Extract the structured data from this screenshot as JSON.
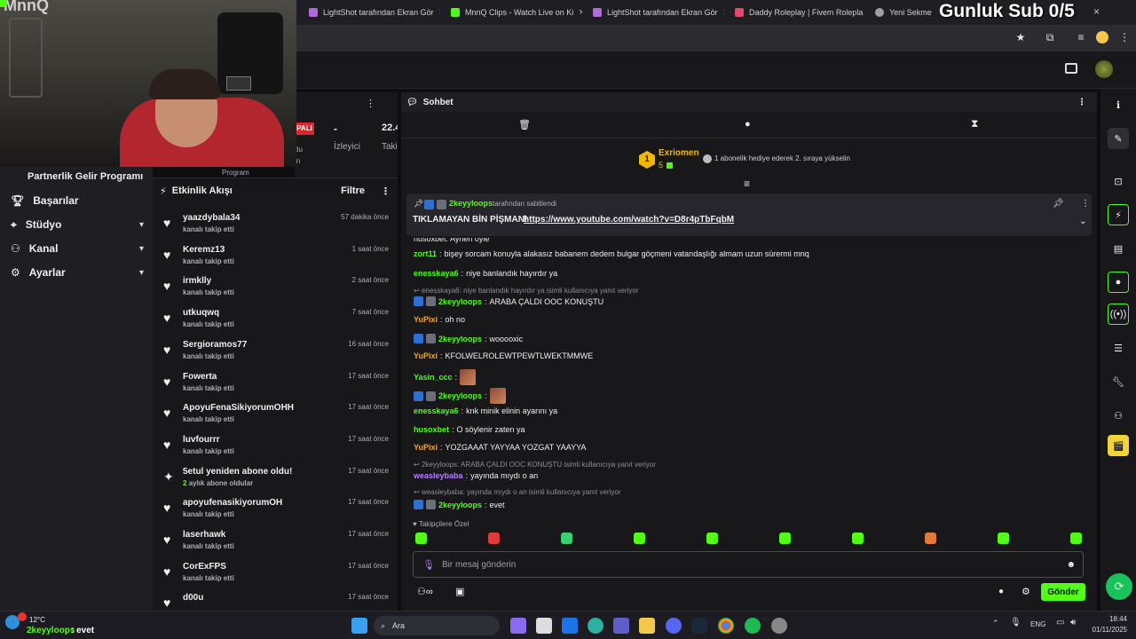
{
  "browser": {
    "tabs": [
      {
        "title": "LightShot tarafından Ekran Gör",
        "color": "#b06bd6"
      },
      {
        "title": "MnnQ Clips - Watch Live on Ki",
        "color": "#53fc18"
      },
      {
        "title": "LightShot tarafından Ekran Gör",
        "color": "#b06bd6"
      },
      {
        "title": "Daddy Roleplay | Fivem Rolepla",
        "color": "#e04a6a"
      },
      {
        "title": "Yeni Sekme",
        "color": "#9aa0a6"
      }
    ]
  },
  "overlay": {
    "sub_goal": "Gunluk Sub 0/5",
    "webcam_label": "MnnQ"
  },
  "left_nav": {
    "partner_program": "Partnerlik Gelir Programı",
    "items": [
      {
        "label": "Başarılar",
        "icon": "trophy-icon"
      },
      {
        "label": "Stüdyo",
        "icon": "studio-icon"
      },
      {
        "label": "Kanal",
        "icon": "channel-icon"
      },
      {
        "label": "Ayarlar",
        "icon": "gear-icon"
      }
    ]
  },
  "stats": {
    "live_badge": "PALI",
    "viewers_value": "-",
    "viewers_label": "İzleyici",
    "followers_value": "22.4",
    "followers_label": "Taki",
    "fragment_1": "du",
    "fragment_2": "in",
    "fragment_3": "Program"
  },
  "activity": {
    "title": "Etkinlik Akışı",
    "filter": "Filtre",
    "rows": [
      {
        "name": "yaazdybala34",
        "action": "kanalı takip etti",
        "time": "57 dakika önce",
        "icon": "heart"
      },
      {
        "name": "Keremz13",
        "action": "kanalı takip etti",
        "time": "1 saat önce",
        "icon": "heart"
      },
      {
        "name": "irmklly",
        "action": "kanalı takip etti",
        "time": "2 saat önce",
        "icon": "heart"
      },
      {
        "name": "utkuqwq",
        "action": "kanalı takip etti",
        "time": "7 saat önce",
        "icon": "heart"
      },
      {
        "name": "Sergioramos77",
        "action": "kanalı takip etti",
        "time": "16 saat önce",
        "icon": "heart"
      },
      {
        "name": "Fowerta",
        "action": "kanalı takip etti",
        "time": "17 saat önce",
        "icon": "heart"
      },
      {
        "name": "ApoyuFenaSikiyorumOHH",
        "action": "kanalı takip etti",
        "time": "17 saat önce",
        "icon": "heart"
      },
      {
        "name": "luvfourrr",
        "action": "kanalı takip etti",
        "time": "17 saat önce",
        "icon": "heart"
      },
      {
        "name": "5etul yeniden abone oldu!",
        "action_prefix": "2",
        "action": " aylık abone oldular",
        "time": "17 saat önce",
        "icon": "sparkle"
      },
      {
        "name": "apoyufenasikiyorumOH",
        "action": "kanalı takip etti",
        "time": "17 saat önce",
        "icon": "heart"
      },
      {
        "name": "laserhawk",
        "action": "kanalı takip etti",
        "time": "17 saat önce",
        "icon": "heart"
      },
      {
        "name": "CorExFPS",
        "action": "kanalı takip etti",
        "time": "17 saat önce",
        "icon": "heart"
      },
      {
        "name": "d00u",
        "action": "",
        "time": "17 saat önce",
        "icon": "heart"
      }
    ]
  },
  "chat": {
    "title": "Sohbet",
    "top_gifter": {
      "rank": "1",
      "name": "Exriomen",
      "count": "5",
      "hint": "1 abonelik hediye ederek 2. sıraya yükselin"
    },
    "pinned": {
      "by_user": "2keyyloops",
      "by_text": "tarafından sabitlendi",
      "text": "TIKLAMAYAN BİN PİŞMAN!",
      "link": "https://www.youtube.com/watch?v=D8r4pTbFqbM"
    },
    "partial_top": "husoxbet: Aynen öyle",
    "messages": [
      {
        "user": "zort11",
        "color": "#53fc18",
        "text": "bişey sorcam konuyla alakasız babanem dedem bulgar göçmeni vatandaşlığı almam uzun sürermi mnq",
        "badges": 0
      },
      {
        "user": "enesskaya6",
        "color": "#53fc18",
        "text": "niye banlandık hayırdır ya",
        "badges": 0
      },
      {
        "reply": "enesskaya6: niye banlandık hayırdır ya isimli kullanıcıya yanıt veriyor"
      },
      {
        "user": "2keyyloops",
        "color": "#53fc18",
        "text": "ARABA ÇALDI OOC KONUŞTU",
        "badges": 2
      },
      {
        "user": "YuPixi",
        "color": "#f5a623",
        "text": "oh no",
        "badges": 0
      },
      {
        "user": "2keyyloops",
        "color": "#53fc18",
        "text": "wooooxic",
        "badges": 2
      },
      {
        "user": "YuPixi",
        "color": "#f5a623",
        "text": "KFOLWELROLEWTPEWTLWEKTMMWE",
        "badges": 0
      },
      {
        "user": "Yasin_ccc",
        "color": "#53fc18",
        "text": "",
        "emote": true,
        "badges": 0
      },
      {
        "user": "2keyyloops",
        "color": "#53fc18",
        "text": "",
        "emote": true,
        "badges": 2
      },
      {
        "user": "enesskaya6",
        "color": "#53fc18",
        "text": "knk minik elinin ayarını ya",
        "badges": 0
      },
      {
        "user": "husoxbet",
        "color": "#53fc18",
        "text": "O söylenir zaten ya",
        "badges": 0
      },
      {
        "user": "YuPixi",
        "color": "#f5a623",
        "text": "YOZGAAAT YAYYAA YOZGAT YAAYYA",
        "badges": 0
      },
      {
        "reply": "2keyyloops: ARABA ÇALDI OOC KONUŞTU isimli kullanıcıya yanıt veriyor"
      },
      {
        "user": "weasleybaba",
        "color": "#b77dff",
        "text": "yayında mıydı o an",
        "badges": 0
      },
      {
        "reply": "weasleybaba: yayında mıydı o an isimli kullanıcıya yanıt veriyor"
      },
      {
        "user": "2keyyloops",
        "color": "#53fc18",
        "text": "evet",
        "badges": 2
      }
    ],
    "followers_only": "Takipçilere Özel",
    "input_placeholder": "Bir mesaj gönderin",
    "send_label": "Gönder"
  },
  "taskbar": {
    "weather": "12°C",
    "toast_user": "2keyyloops",
    "toast_text": ": evet",
    "search_label": "Ara",
    "lang": "ENG",
    "time": "18:44",
    "date": "01/11/2025"
  },
  "colors": {
    "accent": "#53fc18",
    "bg": "#0e0e10",
    "panel": "#18181b"
  }
}
